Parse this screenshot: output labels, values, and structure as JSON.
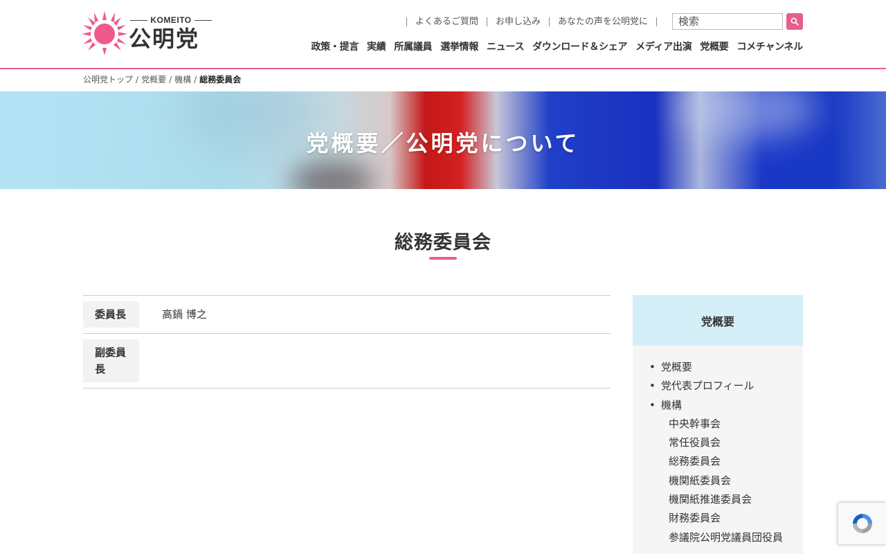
{
  "header": {
    "logo": {
      "sub": "KOMEITO",
      "name": "公明党"
    },
    "util_links": [
      "よくあるご質問",
      "お申し込み",
      "あなたの声を公明党に"
    ],
    "search": {
      "placeholder": "検索"
    },
    "nav": [
      "政策・提言",
      "実績",
      "所属議員",
      "選挙情報",
      "ニュース",
      "ダウンロード＆シェア",
      "メディア出演",
      "党概要",
      "コメチャンネル"
    ]
  },
  "breadcrumb": {
    "items": [
      "公明党トップ",
      "党概要",
      "機構"
    ],
    "current": "総務委員会"
  },
  "hero": {
    "title": "党概要／公明党について"
  },
  "page": {
    "title": "総務委員会"
  },
  "members": [
    {
      "role": "委員長",
      "name": "高鍋 博之"
    },
    {
      "role": "副委員長",
      "name": ""
    }
  ],
  "sidebar": {
    "heading": "党概要",
    "items": [
      {
        "label": "党概要",
        "level": 1
      },
      {
        "label": "党代表プロフィール",
        "level": 1
      },
      {
        "label": "機構",
        "level": 1
      },
      {
        "label": "中央幹事会",
        "level": 2
      },
      {
        "label": "常任役員会",
        "level": 2
      },
      {
        "label": "総務委員会",
        "level": 2
      },
      {
        "label": "機関紙委員会",
        "level": 2
      },
      {
        "label": "機関紙推進委員会",
        "level": 2
      },
      {
        "label": "財務委員会",
        "level": 2
      },
      {
        "label": "参議院公明党議員団役員",
        "level": 2
      }
    ]
  },
  "colors": {
    "accent": "#e85d8a",
    "sidebar_head": "#d5eff9",
    "sun": "#f05a8a"
  }
}
